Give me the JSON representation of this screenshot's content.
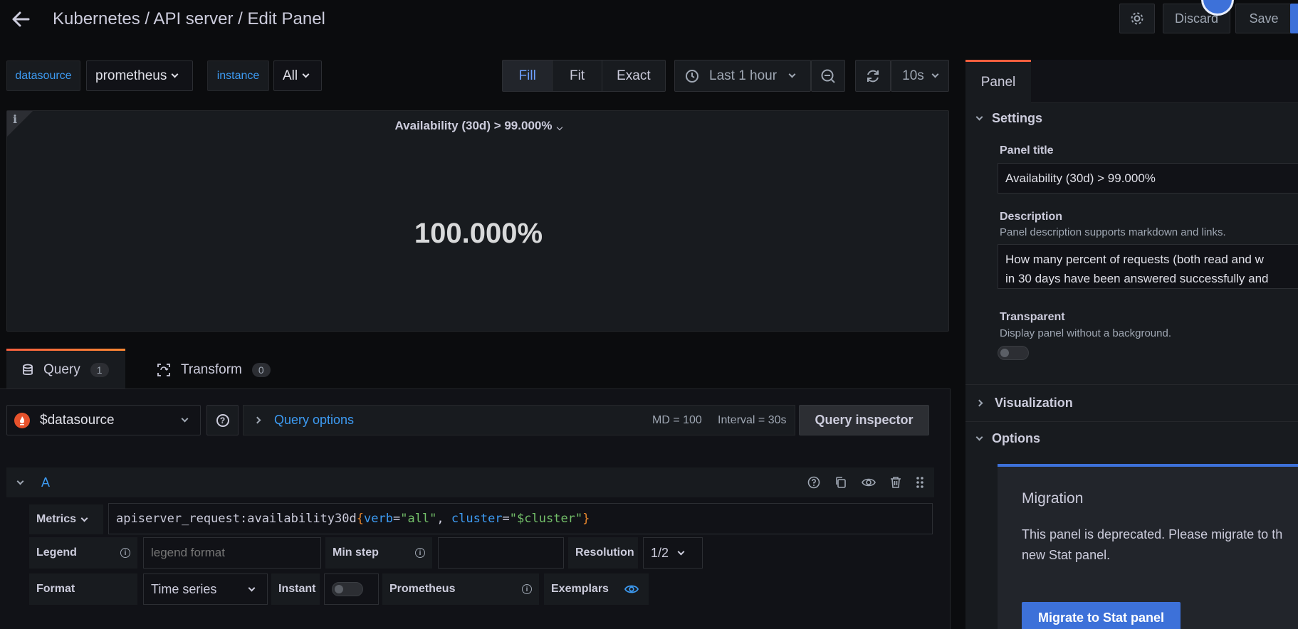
{
  "header": {
    "breadcrumb": "Kubernetes / API server / Edit Panel",
    "discard_label": "Discard",
    "save_label": "Save"
  },
  "vars": [
    {
      "name": "datasource",
      "value": "prometheus"
    },
    {
      "name": "instance",
      "value": "All"
    }
  ],
  "view_modes": [
    "Fill",
    "Fit",
    "Exact"
  ],
  "active_view_mode": "Fill",
  "time_range": "Last 1 hour",
  "refresh_interval": "10s",
  "panel_preview": {
    "title": "Availability (30d) > 99.000%",
    "value": "100.000%",
    "info": "i"
  },
  "tabs": [
    {
      "label": "Query",
      "count": "1"
    },
    {
      "label": "Transform",
      "count": "0"
    }
  ],
  "query_bar": {
    "datasource": "$datasource",
    "help": "?",
    "options_label": "Query options",
    "md": "MD = 100",
    "interval": "Interval = 30s",
    "inspector_label": "Query inspector"
  },
  "query": {
    "ref_id": "A",
    "metrics_label": "Metrics",
    "expr_metric": "apiserver_request:availability30d",
    "expr_open": "{",
    "expr_k1": "verb",
    "expr_eq1": "=",
    "expr_v1": "\"all\"",
    "expr_sep": ", ",
    "expr_k2": "cluster",
    "expr_eq2": "=",
    "expr_v2": "\"$cluster\"",
    "expr_close": "}",
    "legend_label": "Legend",
    "legend_placeholder": "legend format",
    "min_step_label": "Min step",
    "resolution_label": "Resolution",
    "resolution_value": "1/2",
    "format_label": "Format",
    "format_value": "Time series",
    "instant_label": "Instant",
    "prometheus_label": "Prometheus",
    "exemplars_label": "Exemplars"
  },
  "right_panel": {
    "tab": "Panel",
    "settings_label": "Settings",
    "panel_title_label": "Panel title",
    "panel_title_value": "Availability (30d) > 99.000%",
    "description_label": "Description",
    "description_help": "Panel description supports markdown and links.",
    "description_line1": "How many percent of requests (both read and w",
    "description_line2": "in 30 days have been answered successfully and",
    "transparent_label": "Transparent",
    "transparent_help": "Display panel without a background.",
    "visualization_label": "Visualization",
    "options_label": "Options",
    "migration_title": "Migration",
    "migration_line1": "This panel is deprecated. Please migrate to th",
    "migration_line2": "new Stat panel.",
    "migrate_button": "Migrate to Stat panel"
  },
  "colors": {
    "accent": "#3d71d9",
    "link": "#6e9fff",
    "tab_gradient_start": "#f55f3e",
    "tab_gradient_end": "#ff8833"
  }
}
